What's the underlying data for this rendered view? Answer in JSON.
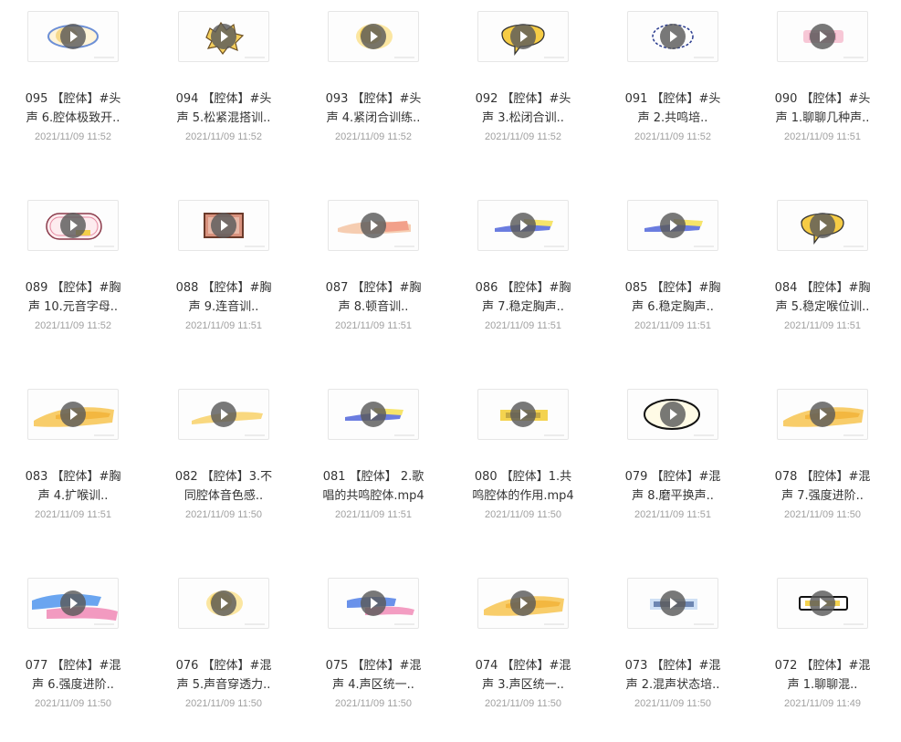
{
  "files": [
    {
      "line1": "095 【腔体】#头",
      "line2": "声 6.腔体极致开..",
      "date": "2021/11/09 11:52",
      "thumb": "oval-cream"
    },
    {
      "line1": "094 【腔体】#头",
      "line2": "声 5.松紧混搭训..",
      "date": "2021/11/09 11:52",
      "thumb": "spiky-yellow"
    },
    {
      "line1": "093 【腔体】#头",
      "line2": "声 4.紧闭合训练..",
      "date": "2021/11/09 11:52",
      "thumb": "splash-yellow"
    },
    {
      "line1": "092 【腔体】#头",
      "line2": "声 3.松闭合训..",
      "date": "2021/11/09 11:52",
      "thumb": "bubble-yellow"
    },
    {
      "line1": "091 【腔体】#头",
      "line2": "声 2.共鸣培..",
      "date": "2021/11/09 11:52",
      "thumb": "dashed-oval"
    },
    {
      "line1": "090 【腔体】#头",
      "line2": "声 1.聊聊几种声..",
      "date": "2021/11/09 11:51",
      "thumb": "pink-label"
    },
    {
      "line1": "089 【腔体】#胸",
      "line2": "声 10.元音字母..",
      "date": "2021/11/09 11:52",
      "thumb": "pink-oval"
    },
    {
      "line1": "088 【腔体】#胸",
      "line2": "声 9.连音训..",
      "date": "2021/11/09 11:51",
      "thumb": "frame-red"
    },
    {
      "line1": "087 【腔体】#胸",
      "line2": "声 8.顿音训..",
      "date": "2021/11/09 11:51",
      "thumb": "stroke-peach"
    },
    {
      "line1": "086 【腔体】#胸",
      "line2": "声 7.稳定胸声..",
      "date": "2021/11/09 11:51",
      "thumb": "stroke-blue-yellow"
    },
    {
      "line1": "085 【腔体】#胸",
      "line2": "声 6.稳定胸声..",
      "date": "2021/11/09 11:51",
      "thumb": "stroke-blue-yellow"
    },
    {
      "line1": "084 【腔体】#胸",
      "line2": "声 5.稳定喉位训..",
      "date": "2021/11/09 11:51",
      "thumb": "bubble-yellow"
    },
    {
      "line1": "083 【腔体】#胸",
      "line2": "声 4.扩喉训..",
      "date": "2021/11/09 11:51",
      "thumb": "stroke-yellow"
    },
    {
      "line1": "082 【腔体】3.不",
      "line2": "同腔体音色感..",
      "date": "2021/11/09 11:50",
      "thumb": "stroke-yellow-thin"
    },
    {
      "line1": "081 【腔体】 2.歌",
      "line2": "唱的共鸣腔体.mp4",
      "date": "2021/11/09 11:51",
      "thumb": "stroke-blue-yellow"
    },
    {
      "line1": "080 【腔体】1.共",
      "line2": "鸣腔体的作用.mp4",
      "date": "2021/11/09 11:50",
      "thumb": "label-yellow"
    },
    {
      "line1": "079 【腔体】#混",
      "line2": "声 8.磨平换声..",
      "date": "2021/11/09 11:51",
      "thumb": "black-oval"
    },
    {
      "line1": "078 【腔体】#混",
      "line2": "声 7.强度进阶..",
      "date": "2021/11/09 11:50",
      "thumb": "stroke-yellow"
    },
    {
      "line1": "077 【腔体】#混",
      "line2": "声 6.强度进阶..",
      "date": "2021/11/09 11:50",
      "thumb": "stroke-blue-pink"
    },
    {
      "line1": "076 【腔体】#混",
      "line2": "声 5.声音穿透力..",
      "date": "2021/11/09 11:50",
      "thumb": "splash-yellow"
    },
    {
      "line1": "075 【腔体】#混",
      "line2": "声 4.声区统一..",
      "date": "2021/11/09 11:50",
      "thumb": "stroke-blue-pink-small"
    },
    {
      "line1": "074 【腔体】#混",
      "line2": "声 3.声区统一..",
      "date": "2021/11/09 11:50",
      "thumb": "stroke-yellow"
    },
    {
      "line1": "073 【腔体】#混",
      "line2": "声 2.混声状态培..",
      "date": "2021/11/09 11:50",
      "thumb": "label-blue"
    },
    {
      "line1": "072 【腔体】#混",
      "line2": "声 1.聊聊混..",
      "date": "2021/11/09 11:49",
      "thumb": "black-label"
    }
  ]
}
